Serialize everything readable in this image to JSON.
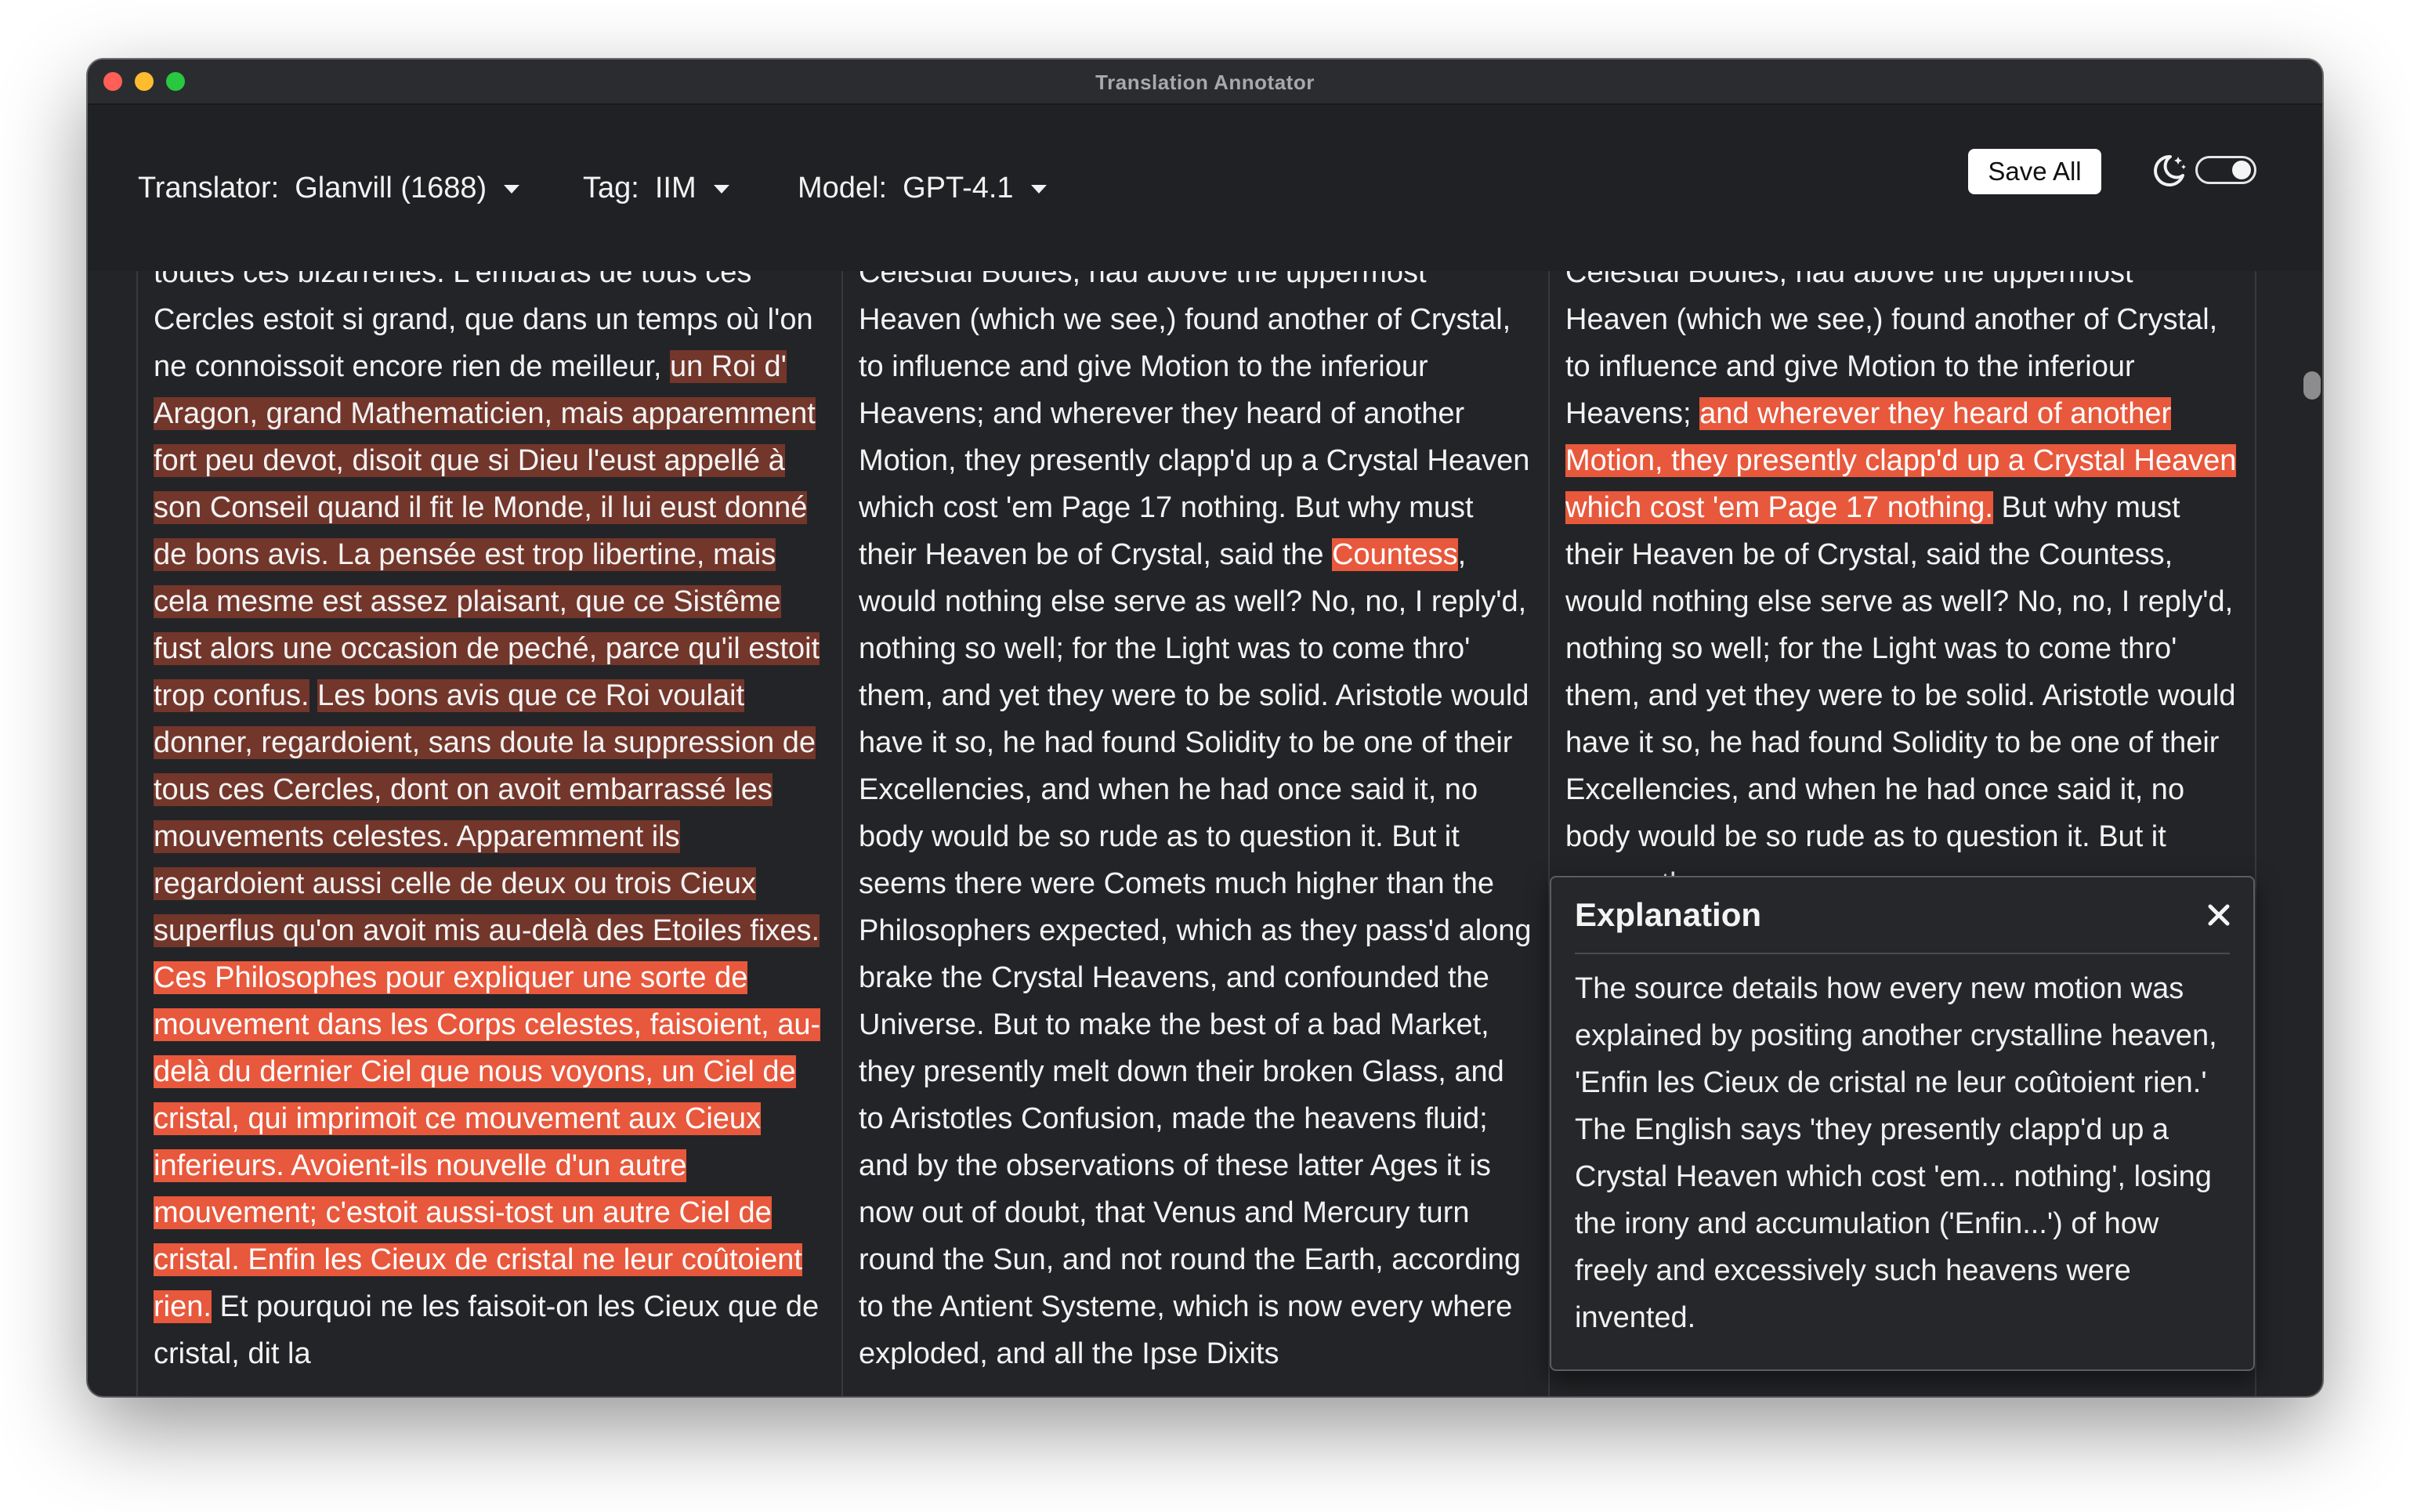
{
  "window": {
    "title": "Translation Annotator"
  },
  "toolbar": {
    "translator": {
      "label": "Translator:",
      "value": "Glanvill (1688)"
    },
    "tag": {
      "label": "Tag:",
      "value": "IIM"
    },
    "model": {
      "label": "Model:",
      "value": "GPT-4.1"
    },
    "save_all_label": "Save All",
    "theme_icon": "moon-stars-icon",
    "dark_mode_toggle": "on"
  },
  "columns": {
    "source": [
      {
        "text": "toutes ces bizarreries. L'embaras de tous ces Cercles estoit si grand, que dans un temps où l'on ne connoissoit encore rien de meilleur, ",
        "hl": "none"
      },
      {
        "text": "un Roi d' Aragon, grand Mathematicien, mais apparemment fort peu devot, disoit que si Dieu l'eust appellé à son Conseil quand il fit le Monde, il lui eust donné de bons avis. La pensée est trop libertine, mais cela mesme est assez plaisant, que ce Sistême fust alors une occasion de peché, parce qu'il estoit trop confus.",
        "hl": "dark"
      },
      {
        "text": " ",
        "hl": "none"
      },
      {
        "text": "Les bons avis que ce Roi voulait donner, regardoient, sans doute la suppression de tous ces Cercles, dont on avoit embarrassé les mouvements celestes. Apparemment ils regardoient aussi celle de deux ou trois Cieux superflus qu'on avoit mis au-delà des Etoiles fixes.",
        "hl": "dark"
      },
      {
        "text": " ",
        "hl": "none"
      },
      {
        "text": "Ces Philosophes pour expliquer une sorte de mouvement dans les Corps celestes, faisoient, au-delà du dernier Ciel que nous voyons, un Ciel de cristal, qui imprimoit ce mouvement aux Cieux inferieurs. Avoient-ils nouvelle d'un autre mouvement; c'estoit aussi-tost un autre Ciel de cristal. Enfin les Cieux de cristal ne leur coûtoient rien.",
        "hl": "light"
      },
      {
        "text": " Et pourquoi ne les faisoit-on les Cieux que de cristal, dit la",
        "hl": "none"
      }
    ],
    "translation_a": [
      {
        "text": "Celestial Bodies, had above the uppermost Heaven (which we see,) found another of Crystal, to influence and give Motion to the inferiour Heavens; and wherever they heard of another Motion, they presently clapp'd up a Crystal Heaven which cost 'em Page 17 nothing. But why must their Heaven be of Crystal, said the ",
        "hl": "none"
      },
      {
        "text": "Countess",
        "hl": "light"
      },
      {
        "text": ", would nothing else serve as well? No, no, I reply'd, nothing so well; for the Light was to come thro' them, and yet they were to be solid. Aristotle would have it so, he had found Solidity to be one of their Excellencies, and when he had once said it, no body would be so rude as to question it. But it seems there were Comets much higher than the Philosophers expected, which as they pass'd along brake the Crystal Heavens, and confounded the Universe. But to make the best of a bad Market, they presently melt down their broken Glass, and to Aristotles Confusion, made the heavens fluid; and by the observations of these latter Ages it is now out of doubt, that Venus and Mercury turn round the Sun, and not round the Earth, according to the Antient Systeme, which is now every where exploded, and all the Ipse Dixits",
        "hl": "none"
      }
    ],
    "translation_b": [
      {
        "text": "Celestial Bodies, had above the uppermost Heaven (which we see,) found another of Crystal, to influence and give Motion to the inferiour Heavens; ",
        "hl": "none"
      },
      {
        "text": "and wherever they heard of another Motion, they presently clapp'd up a Crystal Heaven which cost 'em Page 17 nothing.",
        "hl": "light"
      },
      {
        "text": " But why must their Heaven be of Crystal, said the Countess, would nothing else serve as well? No, no, I reply'd, nothing so well; for the Light was to come thro' them, and yet they were to be solid. Aristotle would have it so, he had found Solidity to be one of their Excellencies, and when he had once said it, no body would be so rude as to question it. But it seems there were",
        "hl": "none"
      }
    ]
  },
  "explanation": {
    "title": "Explanation",
    "body": "The source details how every new motion was explained by positing another crystalline heaven, 'Enfin les Cieux de cristal ne leur coûtoient rien.' The English says 'they presently clapp'd up a Crystal Heaven which cost 'em... nothing', losing the irony and accumulation ('Enfin...') of how freely and excessively such heavens were invented.",
    "close_icon": "close-icon"
  },
  "colors": {
    "background": "#232427",
    "highlight_dark": "#73362b",
    "highlight_light": "#e8583c"
  }
}
